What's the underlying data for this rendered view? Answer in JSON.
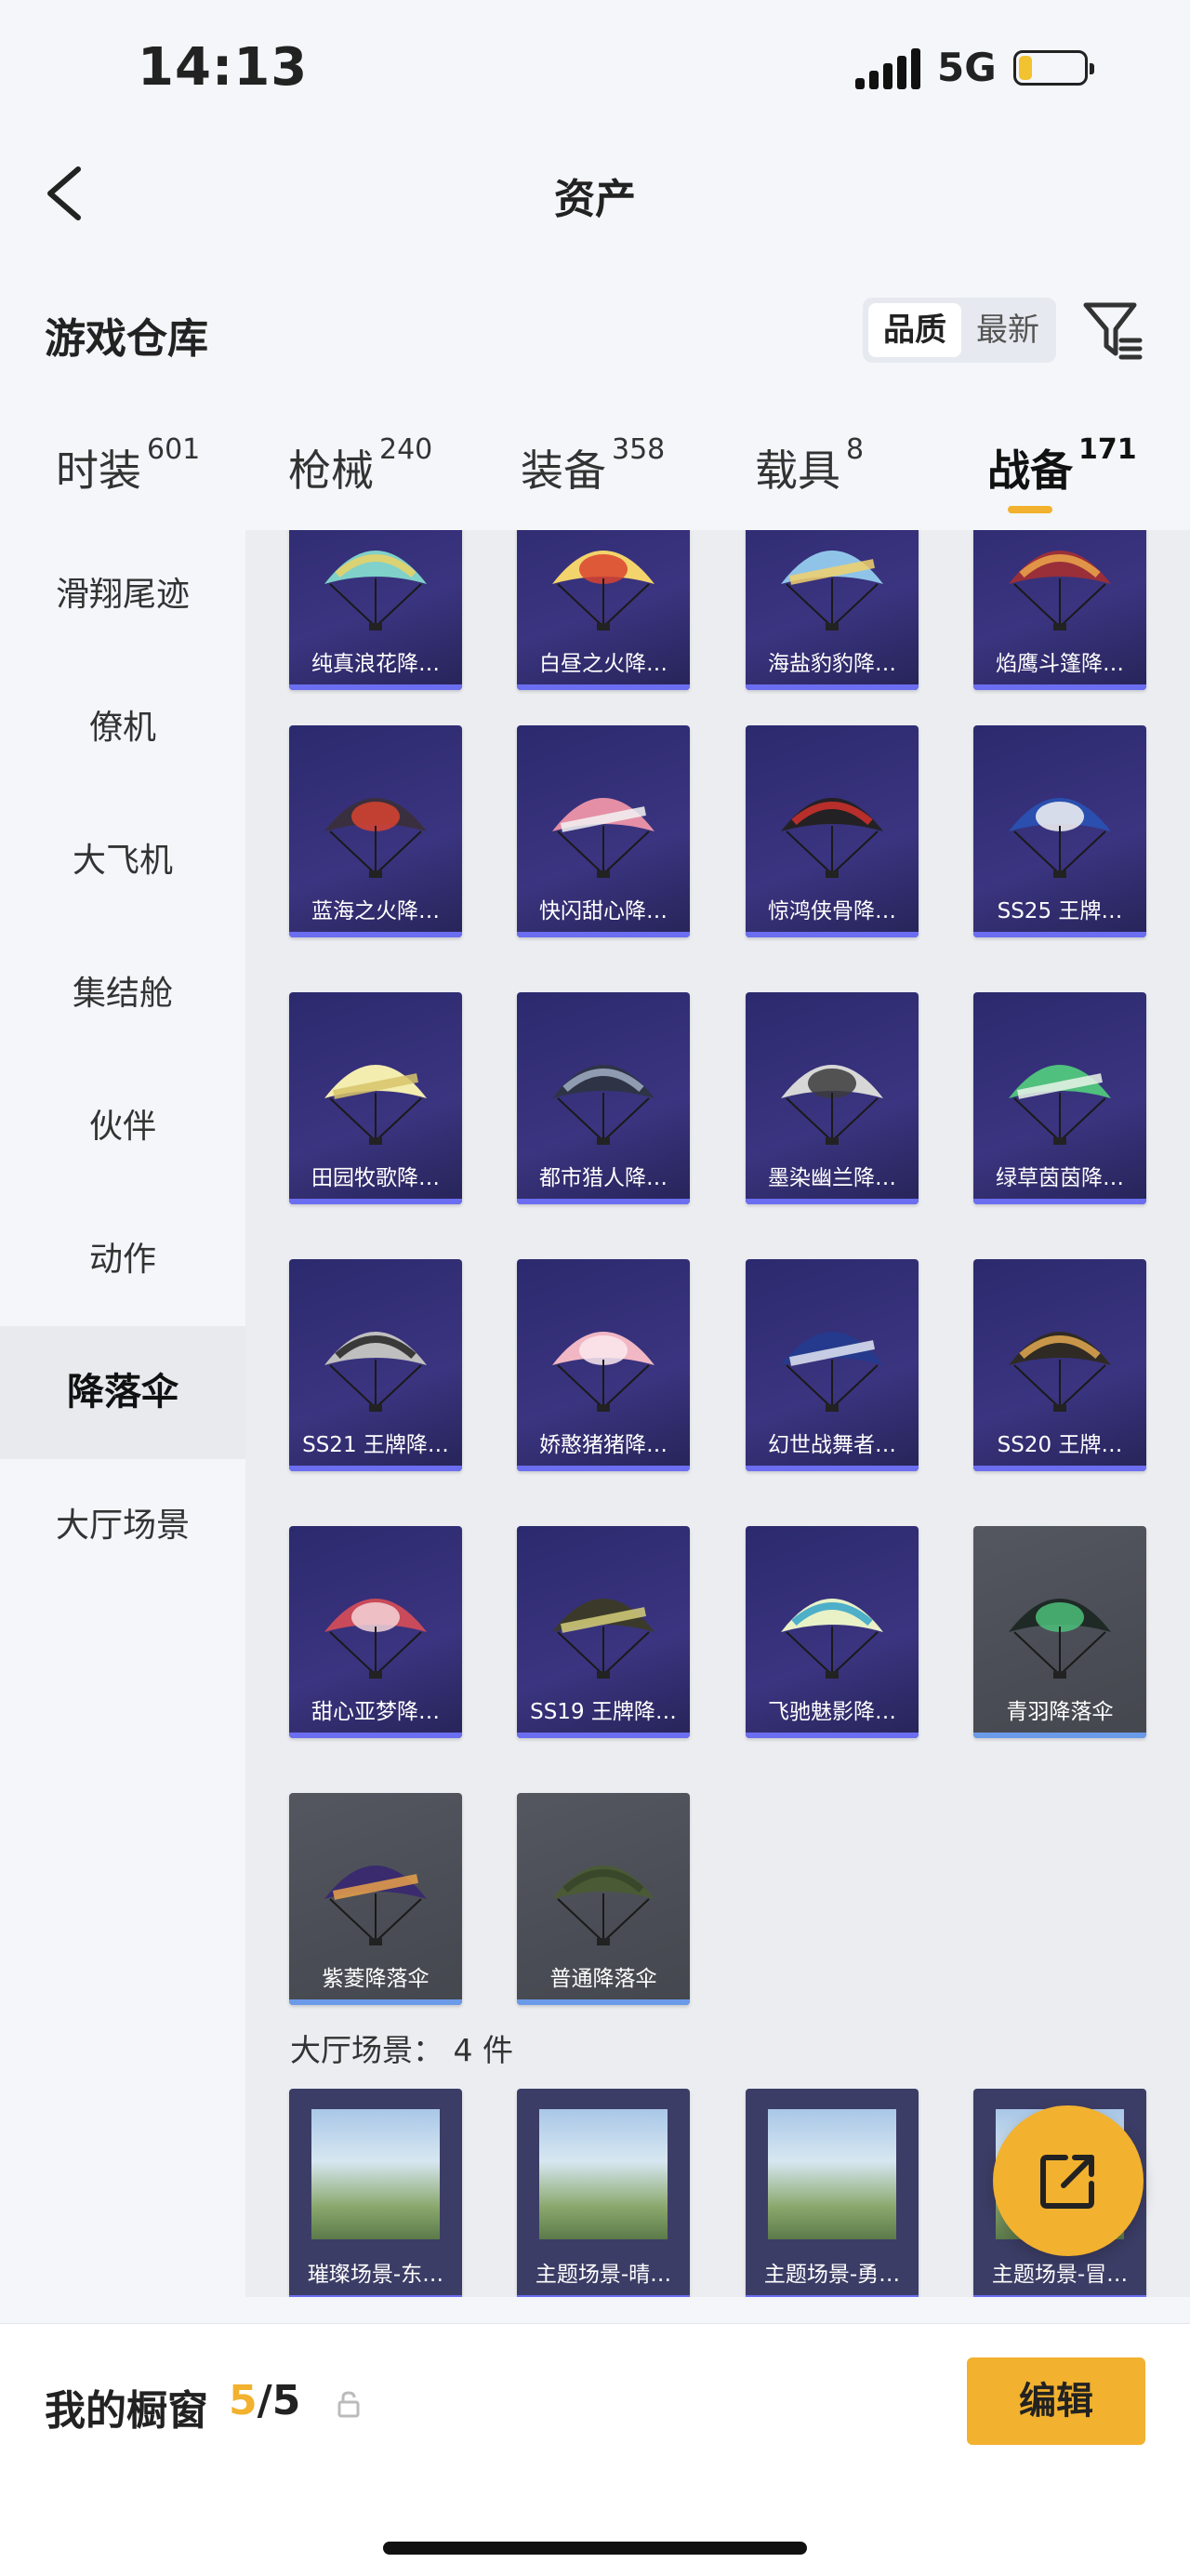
{
  "status_bar": {
    "time": "14:13",
    "network": "5G",
    "battery_level": 0.2
  },
  "nav": {
    "title": "资产"
  },
  "header": {
    "section_title": "游戏仓库",
    "sort_quality": "品质",
    "sort_newest": "最新"
  },
  "tabs": [
    {
      "label": "时装",
      "count": "601",
      "active": false
    },
    {
      "label": "枪械",
      "count": "240",
      "active": false
    },
    {
      "label": "装备",
      "count": "358",
      "active": false
    },
    {
      "label": "载具",
      "count": "8",
      "active": false
    },
    {
      "label": "战备",
      "count": "171",
      "active": true
    }
  ],
  "sidebar": {
    "items": [
      {
        "label": "滑翔尾迹"
      },
      {
        "label": "僚机"
      },
      {
        "label": "大飞机"
      },
      {
        "label": "集结舱"
      },
      {
        "label": "伙伴"
      },
      {
        "label": "动作"
      },
      {
        "label": "降落伞",
        "active": true
      },
      {
        "label": "大厅场景"
      }
    ]
  },
  "parachutes": [
    {
      "name": "纯真浪花降…",
      "style": "purple",
      "color": "#7fd1c9",
      "accent": "#e6d16a"
    },
    {
      "name": "白昼之火降…",
      "style": "purple",
      "color": "#f3d36b",
      "accent": "#d9432f"
    },
    {
      "name": "海盐豹豹降…",
      "style": "purple",
      "color": "#8fc4e8",
      "accent": "#f2d16b"
    },
    {
      "name": "焰鹰斗篷降…",
      "style": "purple",
      "color": "#9a2f3a",
      "accent": "#e8a04a"
    },
    {
      "name": "蓝海之火降…",
      "style": "purple",
      "color": "#3a2f3e",
      "accent": "#d9432f"
    },
    {
      "name": "快闪甜心降…",
      "style": "purple",
      "color": "#e58fa6",
      "accent": "#f4f4f4"
    },
    {
      "name": "惊鸿侠骨降…",
      "style": "purple",
      "color": "#242124",
      "accent": "#c9302c"
    },
    {
      "name": "SS25 王牌…",
      "style": "purple",
      "color": "#2a4fae",
      "accent": "#f4f4f4"
    },
    {
      "name": "田园牧歌降…",
      "style": "purple",
      "color": "#f3edb0",
      "accent": "#d8c46a"
    },
    {
      "name": "都市猎人降…",
      "style": "purple",
      "color": "#2e3446",
      "accent": "#9aa6bd"
    },
    {
      "name": "墨染幽兰降…",
      "style": "purple",
      "color": "#d7d7d7",
      "accent": "#3b3b3b"
    },
    {
      "name": "绿草茵茵降…",
      "style": "purple",
      "color": "#4fc07d",
      "accent": "#e9f4ea"
    },
    {
      "name": "SS21 王牌降…",
      "style": "purple",
      "color": "#bfbfbf",
      "accent": "#2a2a2a"
    },
    {
      "name": "娇憨猪猪降…",
      "style": "purple",
      "color": "#f1b7c4",
      "accent": "#fbe9ee"
    },
    {
      "name": "幻世战舞者…",
      "style": "purple",
      "color": "#253a8c",
      "accent": "#e2e6f3"
    },
    {
      "name": "SS20 王牌…",
      "style": "purple",
      "color": "#2f2a24",
      "accent": "#d9a24f"
    },
    {
      "name": "甜心亚梦降…",
      "style": "purple",
      "color": "#c94a5a",
      "accent": "#f5d3d8"
    },
    {
      "name": "SS19 王牌降…",
      "style": "purple",
      "color": "#3b3a2a",
      "accent": "#d6cf7a"
    },
    {
      "name": "飞驰魅影降…",
      "style": "purple",
      "color": "#e9f1c7",
      "accent": "#3da7c9"
    },
    {
      "name": "青羽降落伞",
      "style": "gray",
      "color": "#1f2a26",
      "accent": "#4cc07a"
    },
    {
      "name": "紫菱降落伞",
      "style": "gray",
      "color": "#3a2b6e",
      "accent": "#e8a04a"
    },
    {
      "name": "普通降落伞",
      "style": "gray",
      "color": "#4a5a35",
      "accent": "#37452a"
    }
  ],
  "lobby_scenes": {
    "label": "大厅场景：",
    "count_text": "4 件",
    "items": [
      {
        "name": "璀璨场景-东…"
      },
      {
        "name": "主题场景-晴…"
      },
      {
        "name": "主题场景-勇…"
      },
      {
        "name": "主题场景-冒…"
      }
    ]
  },
  "footer": {
    "label": "我的橱窗",
    "current": "5",
    "total": "/5",
    "edit_label": "编辑"
  },
  "colors": {
    "accent": "#f2b12e",
    "card_purple": "#2c2a6e",
    "card_gray": "#54575f",
    "rarity_bar": "#6b6ef0"
  }
}
